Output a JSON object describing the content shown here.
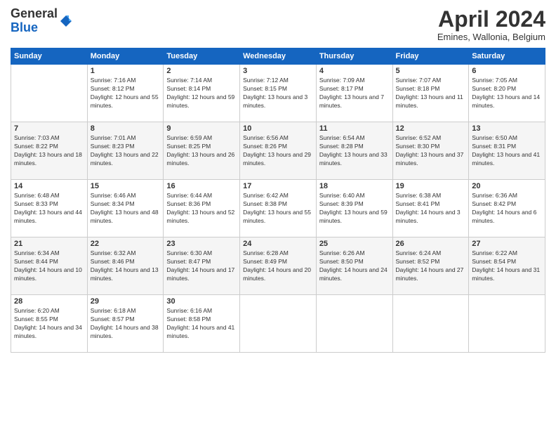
{
  "logo": {
    "general": "General",
    "blue": "Blue"
  },
  "header": {
    "month_year": "April 2024",
    "location": "Emines, Wallonia, Belgium"
  },
  "weekdays": [
    "Sunday",
    "Monday",
    "Tuesday",
    "Wednesday",
    "Thursday",
    "Friday",
    "Saturday"
  ],
  "weeks": [
    [
      {
        "day": "",
        "sunrise": "",
        "sunset": "",
        "daylight": ""
      },
      {
        "day": "1",
        "sunrise": "Sunrise: 7:16 AM",
        "sunset": "Sunset: 8:12 PM",
        "daylight": "Daylight: 12 hours and 55 minutes."
      },
      {
        "day": "2",
        "sunrise": "Sunrise: 7:14 AM",
        "sunset": "Sunset: 8:14 PM",
        "daylight": "Daylight: 12 hours and 59 minutes."
      },
      {
        "day": "3",
        "sunrise": "Sunrise: 7:12 AM",
        "sunset": "Sunset: 8:15 PM",
        "daylight": "Daylight: 13 hours and 3 minutes."
      },
      {
        "day": "4",
        "sunrise": "Sunrise: 7:09 AM",
        "sunset": "Sunset: 8:17 PM",
        "daylight": "Daylight: 13 hours and 7 minutes."
      },
      {
        "day": "5",
        "sunrise": "Sunrise: 7:07 AM",
        "sunset": "Sunset: 8:18 PM",
        "daylight": "Daylight: 13 hours and 11 minutes."
      },
      {
        "day": "6",
        "sunrise": "Sunrise: 7:05 AM",
        "sunset": "Sunset: 8:20 PM",
        "daylight": "Daylight: 13 hours and 14 minutes."
      }
    ],
    [
      {
        "day": "7",
        "sunrise": "Sunrise: 7:03 AM",
        "sunset": "Sunset: 8:22 PM",
        "daylight": "Daylight: 13 hours and 18 minutes."
      },
      {
        "day": "8",
        "sunrise": "Sunrise: 7:01 AM",
        "sunset": "Sunset: 8:23 PM",
        "daylight": "Daylight: 13 hours and 22 minutes."
      },
      {
        "day": "9",
        "sunrise": "Sunrise: 6:59 AM",
        "sunset": "Sunset: 8:25 PM",
        "daylight": "Daylight: 13 hours and 26 minutes."
      },
      {
        "day": "10",
        "sunrise": "Sunrise: 6:56 AM",
        "sunset": "Sunset: 8:26 PM",
        "daylight": "Daylight: 13 hours and 29 minutes."
      },
      {
        "day": "11",
        "sunrise": "Sunrise: 6:54 AM",
        "sunset": "Sunset: 8:28 PM",
        "daylight": "Daylight: 13 hours and 33 minutes."
      },
      {
        "day": "12",
        "sunrise": "Sunrise: 6:52 AM",
        "sunset": "Sunset: 8:30 PM",
        "daylight": "Daylight: 13 hours and 37 minutes."
      },
      {
        "day": "13",
        "sunrise": "Sunrise: 6:50 AM",
        "sunset": "Sunset: 8:31 PM",
        "daylight": "Daylight: 13 hours and 41 minutes."
      }
    ],
    [
      {
        "day": "14",
        "sunrise": "Sunrise: 6:48 AM",
        "sunset": "Sunset: 8:33 PM",
        "daylight": "Daylight: 13 hours and 44 minutes."
      },
      {
        "day": "15",
        "sunrise": "Sunrise: 6:46 AM",
        "sunset": "Sunset: 8:34 PM",
        "daylight": "Daylight: 13 hours and 48 minutes."
      },
      {
        "day": "16",
        "sunrise": "Sunrise: 6:44 AM",
        "sunset": "Sunset: 8:36 PM",
        "daylight": "Daylight: 13 hours and 52 minutes."
      },
      {
        "day": "17",
        "sunrise": "Sunrise: 6:42 AM",
        "sunset": "Sunset: 8:38 PM",
        "daylight": "Daylight: 13 hours and 55 minutes."
      },
      {
        "day": "18",
        "sunrise": "Sunrise: 6:40 AM",
        "sunset": "Sunset: 8:39 PM",
        "daylight": "Daylight: 13 hours and 59 minutes."
      },
      {
        "day": "19",
        "sunrise": "Sunrise: 6:38 AM",
        "sunset": "Sunset: 8:41 PM",
        "daylight": "Daylight: 14 hours and 3 minutes."
      },
      {
        "day": "20",
        "sunrise": "Sunrise: 6:36 AM",
        "sunset": "Sunset: 8:42 PM",
        "daylight": "Daylight: 14 hours and 6 minutes."
      }
    ],
    [
      {
        "day": "21",
        "sunrise": "Sunrise: 6:34 AM",
        "sunset": "Sunset: 8:44 PM",
        "daylight": "Daylight: 14 hours and 10 minutes."
      },
      {
        "day": "22",
        "sunrise": "Sunrise: 6:32 AM",
        "sunset": "Sunset: 8:46 PM",
        "daylight": "Daylight: 14 hours and 13 minutes."
      },
      {
        "day": "23",
        "sunrise": "Sunrise: 6:30 AM",
        "sunset": "Sunset: 8:47 PM",
        "daylight": "Daylight: 14 hours and 17 minutes."
      },
      {
        "day": "24",
        "sunrise": "Sunrise: 6:28 AM",
        "sunset": "Sunset: 8:49 PM",
        "daylight": "Daylight: 14 hours and 20 minutes."
      },
      {
        "day": "25",
        "sunrise": "Sunrise: 6:26 AM",
        "sunset": "Sunset: 8:50 PM",
        "daylight": "Daylight: 14 hours and 24 minutes."
      },
      {
        "day": "26",
        "sunrise": "Sunrise: 6:24 AM",
        "sunset": "Sunset: 8:52 PM",
        "daylight": "Daylight: 14 hours and 27 minutes."
      },
      {
        "day": "27",
        "sunrise": "Sunrise: 6:22 AM",
        "sunset": "Sunset: 8:54 PM",
        "daylight": "Daylight: 14 hours and 31 minutes."
      }
    ],
    [
      {
        "day": "28",
        "sunrise": "Sunrise: 6:20 AM",
        "sunset": "Sunset: 8:55 PM",
        "daylight": "Daylight: 14 hours and 34 minutes."
      },
      {
        "day": "29",
        "sunrise": "Sunrise: 6:18 AM",
        "sunset": "Sunset: 8:57 PM",
        "daylight": "Daylight: 14 hours and 38 minutes."
      },
      {
        "day": "30",
        "sunrise": "Sunrise: 6:16 AM",
        "sunset": "Sunset: 8:58 PM",
        "daylight": "Daylight: 14 hours and 41 minutes."
      },
      {
        "day": "",
        "sunrise": "",
        "sunset": "",
        "daylight": ""
      },
      {
        "day": "",
        "sunrise": "",
        "sunset": "",
        "daylight": ""
      },
      {
        "day": "",
        "sunrise": "",
        "sunset": "",
        "daylight": ""
      },
      {
        "day": "",
        "sunrise": "",
        "sunset": "",
        "daylight": ""
      }
    ]
  ]
}
